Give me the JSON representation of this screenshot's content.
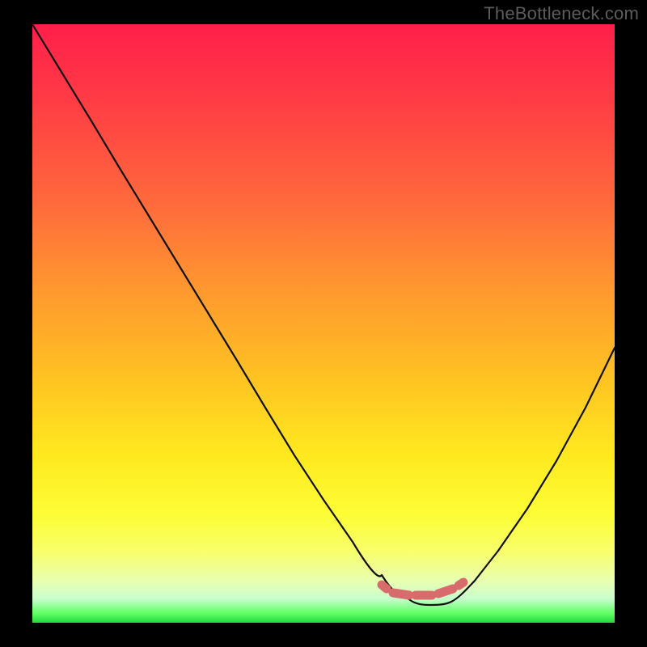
{
  "watermark": "TheBottleneck.com",
  "colors": {
    "background": "#000000",
    "watermark_text": "#5c5c5c",
    "curve_stroke": "#111111",
    "marker_stroke": "#d86c6c",
    "gradient_top": "#ff1f4a",
    "gradient_bottom": "#22d742"
  },
  "chart_data": {
    "type": "line",
    "title": "",
    "xlabel": "",
    "ylabel": "",
    "xlim": [
      0,
      100
    ],
    "ylim": [
      0,
      100
    ],
    "grid": false,
    "legend": false,
    "series": [
      {
        "name": "bottleneck-curve",
        "x": [
          0,
          5,
          10,
          15,
          20,
          25,
          30,
          35,
          40,
          45,
          50,
          55,
          60,
          62,
          64,
          66,
          68,
          70,
          72,
          74,
          76,
          80,
          85,
          90,
          95,
          100
        ],
        "values": [
          100,
          92,
          84,
          76,
          68,
          60,
          52,
          44,
          36,
          28,
          20.5,
          13.5,
          8,
          6,
          4.5,
          3.5,
          3,
          3,
          3.5,
          5,
          7,
          12,
          19,
          27,
          36,
          46
        ]
      }
    ],
    "highlight_band": {
      "name": "optimal-range-marker",
      "x_start": 60,
      "x_end": 74,
      "y": 6
    },
    "note": "y-values estimated from gradient height; x-values normalized 0-100. Minimum (~3) around x≈68-70; right branch climbs to ~46 at x=100."
  }
}
